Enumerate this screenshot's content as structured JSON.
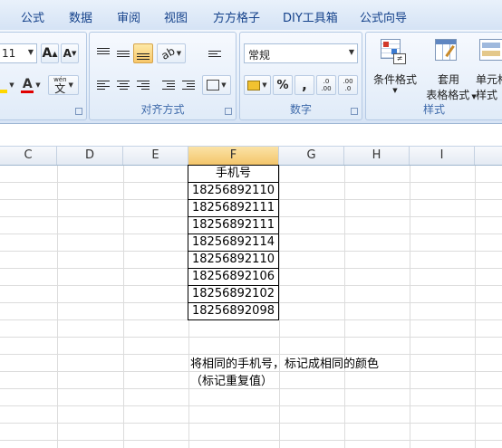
{
  "tabs": [
    "公式",
    "数据",
    "审阅",
    "视图",
    "方方格子",
    "DIY工具箱",
    "公式向导"
  ],
  "font": {
    "size": "11",
    "grow_label": "A",
    "shrink_label": "A",
    "wrap_label": "wén"
  },
  "groups": {
    "alignment": {
      "label": "对齐方式"
    },
    "number": {
      "label": "数字",
      "format": "常规",
      "percent": "%",
      "comma": ",",
      "inc_decimal": ".0\n.00",
      "dec_decimal": ".00\n.0"
    },
    "styles": {
      "label": "样式",
      "conditional_line1": "条件格式",
      "table_line1": "套用",
      "table_line2": "表格格式",
      "cell_line1": "单元格",
      "cell_line2": "样式"
    }
  },
  "columns": [
    "C",
    "D",
    "E",
    "F",
    "G",
    "H",
    "I"
  ],
  "table": {
    "header": "手机号",
    "rows": [
      "18256892110",
      "18256892111",
      "18256892111",
      "18256892114",
      "18256892110",
      "18256892106",
      "18256892102",
      "18256892098"
    ]
  },
  "notes": {
    "line1": "将相同的手机号，标记成相同的颜色",
    "line2": "（标记重复值）"
  },
  "colors": {
    "tab_text": "#15428b",
    "ribbon_bg": "#dfe9f5",
    "selected_header": "#f3c56a",
    "group_label": "#3e6aaa"
  }
}
